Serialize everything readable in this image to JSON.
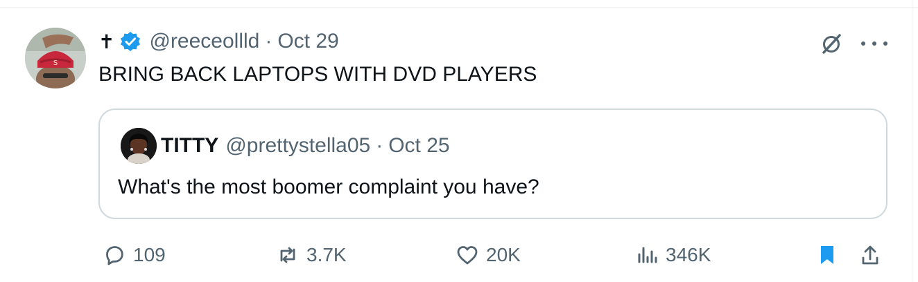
{
  "tweet": {
    "display_name": "✝",
    "handle": "@reeceollld",
    "separator": "·",
    "date": "Oct 29",
    "text": "BRING BACK LAPTOPS WITH DVD PLAYERS"
  },
  "quoted_tweet": {
    "display_name": "TITTY",
    "handle": "@prettystella05",
    "separator": "·",
    "date": "Oct 25",
    "text": "What's the most boomer complaint you have?"
  },
  "actions": {
    "replies": "109",
    "reposts": "3.7K",
    "likes": "20K",
    "views": "346K"
  },
  "icons": {
    "verified": "verified-badge-icon",
    "grok": "grok-icon",
    "more": "more-icon",
    "reply": "reply-icon",
    "repost": "repost-icon",
    "like": "heart-icon",
    "views": "views-icon",
    "bookmark": "bookmark-icon",
    "share": "share-icon"
  },
  "colors": {
    "accent": "#1d9bf0",
    "text_primary": "#0f1419",
    "text_secondary": "#536471",
    "border": "#cfd9de"
  }
}
